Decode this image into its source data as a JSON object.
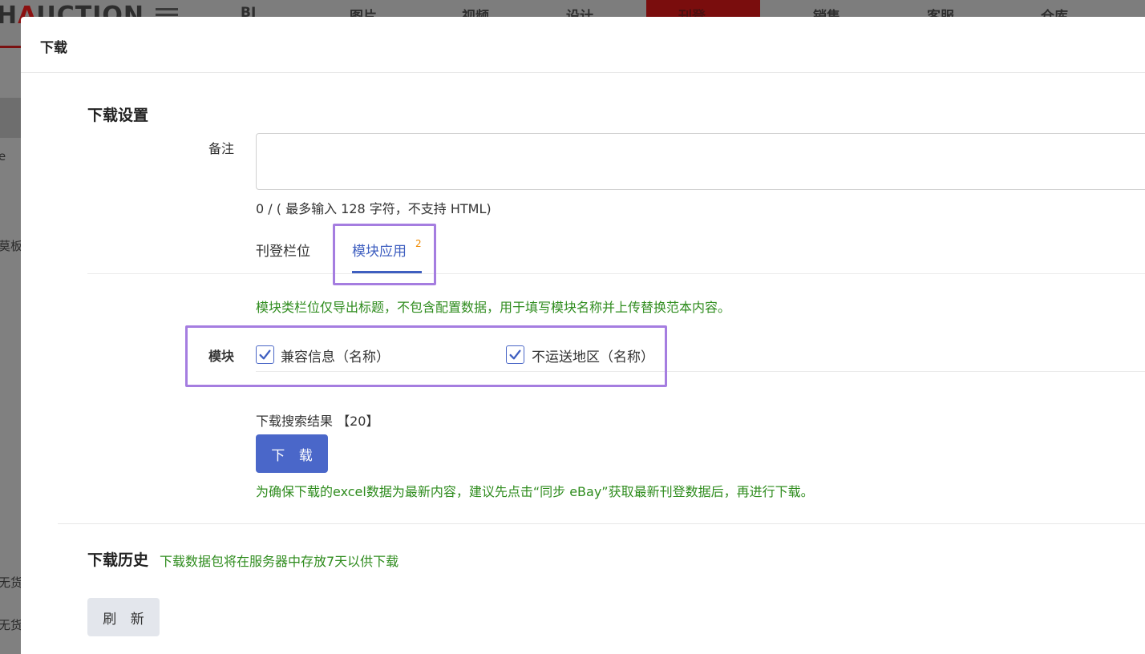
{
  "background_app": {
    "logo_prefix": "H",
    "logo_accent": "A",
    "logo_rest": "UCTION",
    "nav_items": [
      "BI",
      "图片",
      "视频",
      "设计 ⌄",
      "刊登 ⌄",
      "销售 ⌄",
      "客服 ⌄",
      "仓库 ⌄",
      "..."
    ],
    "sidebar_texts": [
      "e",
      "莫板",
      "无货",
      "无货"
    ]
  },
  "modal": {
    "title": "下载",
    "settings": {
      "section_title": "下载设置",
      "remark_label": "备注",
      "remark_value": "",
      "counter_text": "0 / ( 最多输入 128 字符，不支持 HTML)"
    },
    "tabs": [
      {
        "label": "刊登栏位",
        "active": false
      },
      {
        "label": "模块应用",
        "active": true,
        "badge": "2"
      }
    ],
    "module_hint": "模块类栏位仅导出标题，不包含配置数据，用于填写模块名称并上传替换范本内容。",
    "module_label": "模块",
    "modules": [
      {
        "label": "兼容信息（名称）",
        "checked": true
      },
      {
        "label": "不运送地区（名称）",
        "checked": true
      }
    ],
    "download_result_label": "下载搜索结果 【20】",
    "download_button": "下 载",
    "download_hint": "为确保下载的excel数据为最新内容，建议先点击“同步 eBay”获取最新刊登数据后，再进行下载。",
    "history": {
      "section_title": "下载历史",
      "hint": "下载数据包将在服务器中存放7天以供下载",
      "refresh_button": "刷 新"
    }
  },
  "colors": {
    "accent": "#4a67c9",
    "hint_green": "#2f8c1e",
    "badge_orange": "#f08a00",
    "highlight": "#a57de0"
  }
}
